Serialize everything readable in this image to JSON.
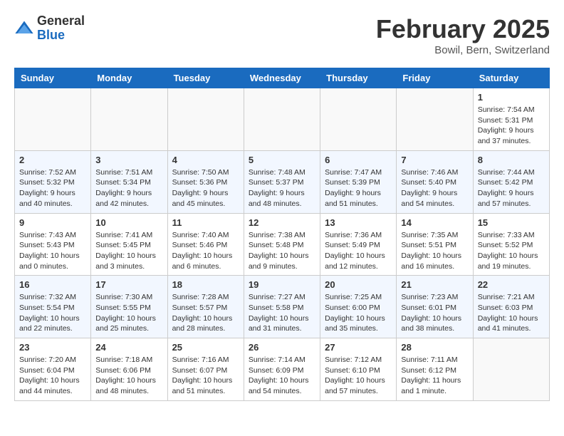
{
  "header": {
    "logo_general": "General",
    "logo_blue": "Blue",
    "month_title": "February 2025",
    "location": "Bowil, Bern, Switzerland"
  },
  "weekdays": [
    "Sunday",
    "Monday",
    "Tuesday",
    "Wednesday",
    "Thursday",
    "Friday",
    "Saturday"
  ],
  "weeks": [
    [
      {
        "day": "",
        "info": ""
      },
      {
        "day": "",
        "info": ""
      },
      {
        "day": "",
        "info": ""
      },
      {
        "day": "",
        "info": ""
      },
      {
        "day": "",
        "info": ""
      },
      {
        "day": "",
        "info": ""
      },
      {
        "day": "1",
        "info": "Sunrise: 7:54 AM\nSunset: 5:31 PM\nDaylight: 9 hours and 37 minutes."
      }
    ],
    [
      {
        "day": "2",
        "info": "Sunrise: 7:52 AM\nSunset: 5:32 PM\nDaylight: 9 hours and 40 minutes."
      },
      {
        "day": "3",
        "info": "Sunrise: 7:51 AM\nSunset: 5:34 PM\nDaylight: 9 hours and 42 minutes."
      },
      {
        "day": "4",
        "info": "Sunrise: 7:50 AM\nSunset: 5:36 PM\nDaylight: 9 hours and 45 minutes."
      },
      {
        "day": "5",
        "info": "Sunrise: 7:48 AM\nSunset: 5:37 PM\nDaylight: 9 hours and 48 minutes."
      },
      {
        "day": "6",
        "info": "Sunrise: 7:47 AM\nSunset: 5:39 PM\nDaylight: 9 hours and 51 minutes."
      },
      {
        "day": "7",
        "info": "Sunrise: 7:46 AM\nSunset: 5:40 PM\nDaylight: 9 hours and 54 minutes."
      },
      {
        "day": "8",
        "info": "Sunrise: 7:44 AM\nSunset: 5:42 PM\nDaylight: 9 hours and 57 minutes."
      }
    ],
    [
      {
        "day": "9",
        "info": "Sunrise: 7:43 AM\nSunset: 5:43 PM\nDaylight: 10 hours and 0 minutes."
      },
      {
        "day": "10",
        "info": "Sunrise: 7:41 AM\nSunset: 5:45 PM\nDaylight: 10 hours and 3 minutes."
      },
      {
        "day": "11",
        "info": "Sunrise: 7:40 AM\nSunset: 5:46 PM\nDaylight: 10 hours and 6 minutes."
      },
      {
        "day": "12",
        "info": "Sunrise: 7:38 AM\nSunset: 5:48 PM\nDaylight: 10 hours and 9 minutes."
      },
      {
        "day": "13",
        "info": "Sunrise: 7:36 AM\nSunset: 5:49 PM\nDaylight: 10 hours and 12 minutes."
      },
      {
        "day": "14",
        "info": "Sunrise: 7:35 AM\nSunset: 5:51 PM\nDaylight: 10 hours and 16 minutes."
      },
      {
        "day": "15",
        "info": "Sunrise: 7:33 AM\nSunset: 5:52 PM\nDaylight: 10 hours and 19 minutes."
      }
    ],
    [
      {
        "day": "16",
        "info": "Sunrise: 7:32 AM\nSunset: 5:54 PM\nDaylight: 10 hours and 22 minutes."
      },
      {
        "day": "17",
        "info": "Sunrise: 7:30 AM\nSunset: 5:55 PM\nDaylight: 10 hours and 25 minutes."
      },
      {
        "day": "18",
        "info": "Sunrise: 7:28 AM\nSunset: 5:57 PM\nDaylight: 10 hours and 28 minutes."
      },
      {
        "day": "19",
        "info": "Sunrise: 7:27 AM\nSunset: 5:58 PM\nDaylight: 10 hours and 31 minutes."
      },
      {
        "day": "20",
        "info": "Sunrise: 7:25 AM\nSunset: 6:00 PM\nDaylight: 10 hours and 35 minutes."
      },
      {
        "day": "21",
        "info": "Sunrise: 7:23 AM\nSunset: 6:01 PM\nDaylight: 10 hours and 38 minutes."
      },
      {
        "day": "22",
        "info": "Sunrise: 7:21 AM\nSunset: 6:03 PM\nDaylight: 10 hours and 41 minutes."
      }
    ],
    [
      {
        "day": "23",
        "info": "Sunrise: 7:20 AM\nSunset: 6:04 PM\nDaylight: 10 hours and 44 minutes."
      },
      {
        "day": "24",
        "info": "Sunrise: 7:18 AM\nSunset: 6:06 PM\nDaylight: 10 hours and 48 minutes."
      },
      {
        "day": "25",
        "info": "Sunrise: 7:16 AM\nSunset: 6:07 PM\nDaylight: 10 hours and 51 minutes."
      },
      {
        "day": "26",
        "info": "Sunrise: 7:14 AM\nSunset: 6:09 PM\nDaylight: 10 hours and 54 minutes."
      },
      {
        "day": "27",
        "info": "Sunrise: 7:12 AM\nSunset: 6:10 PM\nDaylight: 10 hours and 57 minutes."
      },
      {
        "day": "28",
        "info": "Sunrise: 7:11 AM\nSunset: 6:12 PM\nDaylight: 11 hours and 1 minute."
      },
      {
        "day": "",
        "info": ""
      }
    ]
  ]
}
